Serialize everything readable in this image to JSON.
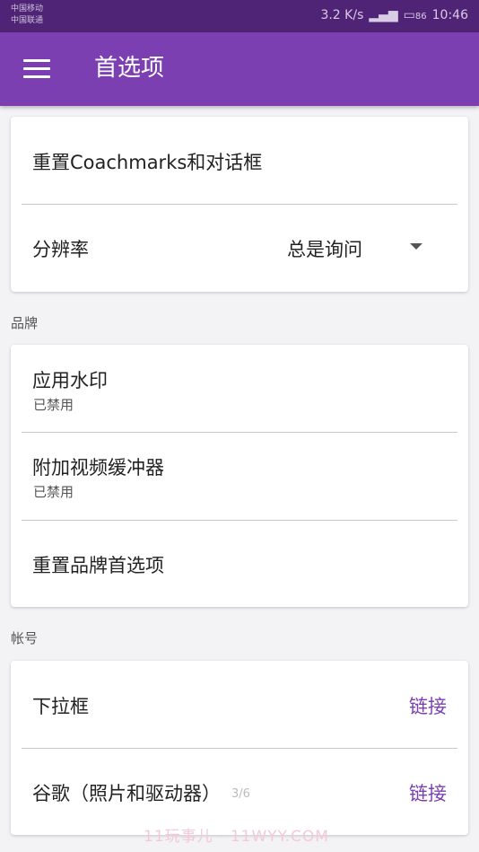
{
  "status_bar": {
    "carrier_1": "中国移动",
    "carrier_2": "中国联通",
    "speed": "3.2 K/s",
    "battery": "86",
    "time": "10:46"
  },
  "app_bar": {
    "menu_icon": "hamburger-menu-icon",
    "title": "首选项"
  },
  "general": {
    "reset_coachmarks": "重置Coachmarks和对话框",
    "resolution_label": "分辨率",
    "resolution_value": "总是询问"
  },
  "branding": {
    "header": "品牌",
    "watermark_label": "应用水印",
    "watermark_status": "已禁用",
    "bumper_label": "附加视频缓冲器",
    "bumper_status": "已禁用",
    "reset_label": "重置品牌首选项"
  },
  "account": {
    "header": "帐号",
    "dropbox_label": "下拉框",
    "dropbox_action": "链接",
    "google_label": "谷歌（照片和驱动器）",
    "google_action": "链接"
  },
  "overlay": {
    "page_indicator": "3/6",
    "watermark_text": "11玩事儿 · 11WYY.COM"
  },
  "colors": {
    "status_bar": "#4f2375",
    "app_bar": "#7b3fb2",
    "accent": "#7b3fb2",
    "background": "#f3f3f6"
  }
}
